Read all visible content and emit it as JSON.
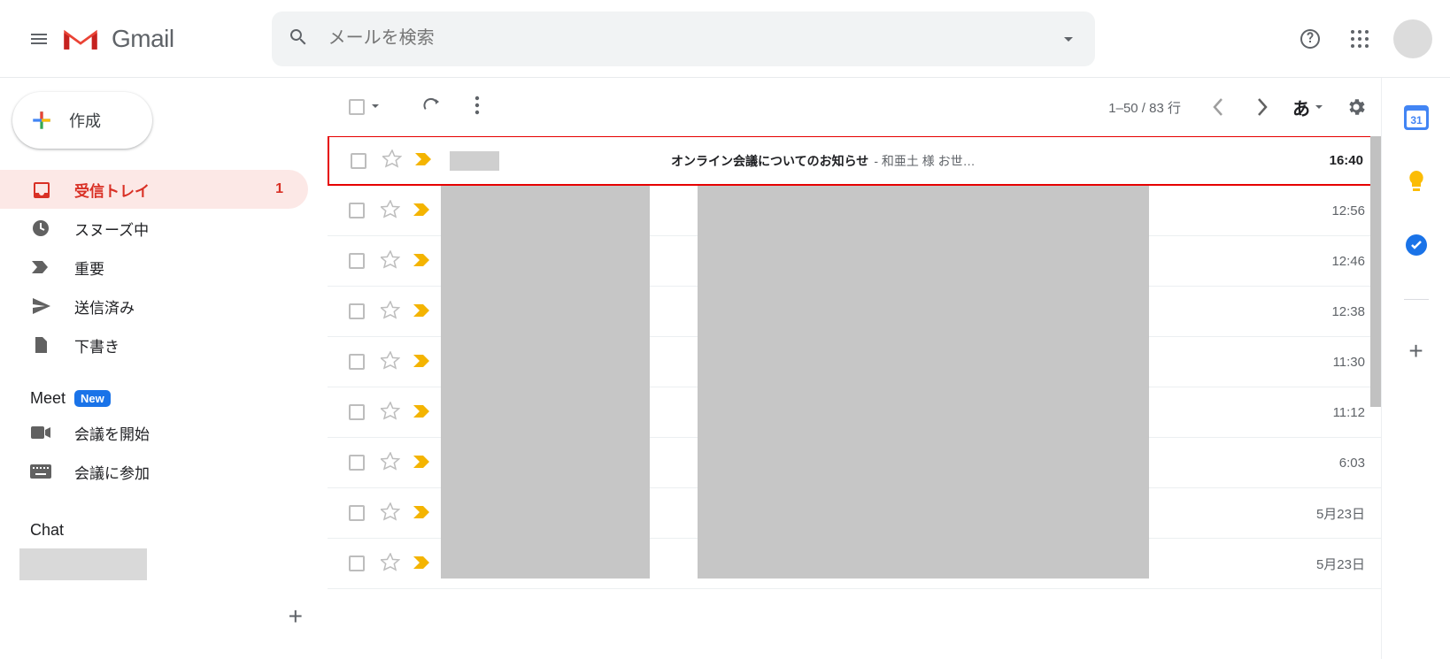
{
  "brand": {
    "name": "Gmail"
  },
  "search": {
    "placeholder": "メールを検索"
  },
  "compose": {
    "label": "作成"
  },
  "sidebar": {
    "items": [
      {
        "label": "受信トレイ",
        "badge": "1"
      },
      {
        "label": "スヌーズ中"
      },
      {
        "label": "重要"
      },
      {
        "label": "送信済み"
      },
      {
        "label": "下書き"
      }
    ],
    "meet": {
      "label": "Meet",
      "new": "New",
      "start": "会議を開始",
      "join": "会議に参加"
    },
    "chat": {
      "label": "Chat"
    }
  },
  "toolbar": {
    "range": "1–50 / 83 行",
    "lang": "あ"
  },
  "messages": [
    {
      "subject": "オンライン会議についてのお知らせ",
      "snippet": " - 和亜土 様 お世…",
      "time": "16:40",
      "highlight": true
    },
    {
      "time": "12:56"
    },
    {
      "time": "12:46"
    },
    {
      "time": "12:38"
    },
    {
      "time": "11:30"
    },
    {
      "time": "11:12"
    },
    {
      "time": "6:03"
    },
    {
      "time": "5月23日"
    },
    {
      "time": "5月23日"
    }
  ]
}
